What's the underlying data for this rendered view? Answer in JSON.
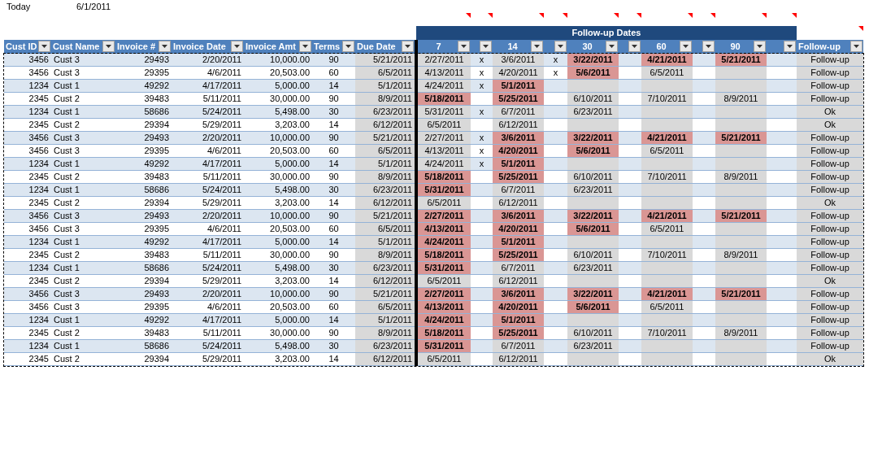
{
  "today": {
    "label": "Today",
    "value": "6/1/2011"
  },
  "group_header": {
    "label": "Follow-up Dates"
  },
  "columns": [
    {
      "label": "Cust ID"
    },
    {
      "label": "Cust Name"
    },
    {
      "label": "Invoice #"
    },
    {
      "label": "Invoice Date"
    },
    {
      "label": "Invoice Amt"
    },
    {
      "label": "Terms"
    },
    {
      "label": "Due Date"
    },
    {
      "label": "7",
      "comment": true
    },
    {
      "comment": true
    },
    {
      "label": "14",
      "comment": true
    },
    {
      "comment": true
    },
    {
      "label": "30",
      "comment": true
    },
    {
      "comment": true
    },
    {
      "label": "60",
      "comment": true
    },
    {
      "comment": true
    },
    {
      "label": "90",
      "comment": true
    },
    {
      "comment": true
    },
    {
      "label": "Follow-up",
      "comment": true
    }
  ],
  "rows": [
    {
      "cust_id": "3456",
      "cust_name": "Cust 3",
      "invoice": "29493",
      "invoice_date": "2/20/2011",
      "invoice_amt": "10,000.00",
      "terms": "90",
      "due_date": "5/21/2011",
      "followups": [
        {
          "date": "2/27/2011",
          "overdue": false
        },
        {
          "date": "3/6/2011",
          "overdue": false
        },
        {
          "date": "3/22/2011",
          "overdue": true
        },
        {
          "date": "4/21/2011",
          "overdue": true
        },
        {
          "date": "5/21/2011",
          "overdue": true
        }
      ],
      "marks": [
        "x",
        "x"
      ],
      "status": "Follow-up"
    },
    {
      "cust_id": "3456",
      "cust_name": "Cust 3",
      "invoice": "29395",
      "invoice_date": "4/6/2011",
      "invoice_amt": "20,503.00",
      "terms": "60",
      "due_date": "6/5/2011",
      "followups": [
        {
          "date": "4/13/2011",
          "overdue": false
        },
        {
          "date": "4/20/2011",
          "overdue": false
        },
        {
          "date": "5/6/2011",
          "overdue": true
        },
        {
          "date": "6/5/2011",
          "overdue": false
        }
      ],
      "marks": [
        "x",
        "x"
      ],
      "status": "Follow-up"
    },
    {
      "cust_id": "1234",
      "cust_name": "Cust 1",
      "invoice": "49292",
      "invoice_date": "4/17/2011",
      "invoice_amt": "5,000.00",
      "terms": "14",
      "due_date": "5/1/2011",
      "followups": [
        {
          "date": "4/24/2011",
          "overdue": false
        },
        {
          "date": "5/1/2011",
          "overdue": true
        }
      ],
      "marks": [
        "x"
      ],
      "status": "Follow-up"
    },
    {
      "cust_id": "2345",
      "cust_name": "Cust 2",
      "invoice": "39483",
      "invoice_date": "5/11/2011",
      "invoice_amt": "30,000.00",
      "terms": "90",
      "due_date": "8/9/2011",
      "followups": [
        {
          "date": "5/18/2011",
          "overdue": true
        },
        {
          "date": "5/25/2011",
          "overdue": true
        },
        {
          "date": "6/10/2011",
          "overdue": false
        },
        {
          "date": "7/10/2011",
          "overdue": false
        },
        {
          "date": "8/9/2011",
          "overdue": false
        }
      ],
      "status": "Follow-up"
    },
    {
      "cust_id": "1234",
      "cust_name": "Cust 1",
      "invoice": "58686",
      "invoice_date": "5/24/2011",
      "invoice_amt": "5,498.00",
      "terms": "30",
      "due_date": "6/23/2011",
      "followups": [
        {
          "date": "5/31/2011",
          "overdue": false
        },
        {
          "date": "6/7/2011",
          "overdue": false
        },
        {
          "date": "6/23/2011",
          "overdue": false
        }
      ],
      "marks": [
        "x"
      ],
      "status": "Ok"
    },
    {
      "cust_id": "2345",
      "cust_name": "Cust 2",
      "invoice": "29394",
      "invoice_date": "5/29/2011",
      "invoice_amt": "3,203.00",
      "terms": "14",
      "due_date": "6/12/2011",
      "followups": [
        {
          "date": "6/5/2011",
          "overdue": false
        },
        {
          "date": "6/12/2011",
          "overdue": false
        }
      ],
      "status": "Ok"
    },
    {
      "cust_id": "3456",
      "cust_name": "Cust 3",
      "invoice": "29493",
      "invoice_date": "2/20/2011",
      "invoice_amt": "10,000.00",
      "terms": "90",
      "due_date": "5/21/2011",
      "followups": [
        {
          "date": "2/27/2011",
          "overdue": false
        },
        {
          "date": "3/6/2011",
          "overdue": true
        },
        {
          "date": "3/22/2011",
          "overdue": true
        },
        {
          "date": "4/21/2011",
          "overdue": true
        },
        {
          "date": "5/21/2011",
          "overdue": true
        }
      ],
      "marks": [
        "x"
      ],
      "status": "Follow-up"
    },
    {
      "cust_id": "3456",
      "cust_name": "Cust 3",
      "invoice": "29395",
      "invoice_date": "4/6/2011",
      "invoice_amt": "20,503.00",
      "terms": "60",
      "due_date": "6/5/2011",
      "followups": [
        {
          "date": "4/13/2011",
          "overdue": false
        },
        {
          "date": "4/20/2011",
          "overdue": true
        },
        {
          "date": "5/6/2011",
          "overdue": true
        },
        {
          "date": "6/5/2011",
          "overdue": false
        }
      ],
      "marks": [
        "x"
      ],
      "status": "Follow-up"
    },
    {
      "cust_id": "1234",
      "cust_name": "Cust 1",
      "invoice": "49292",
      "invoice_date": "4/17/2011",
      "invoice_amt": "5,000.00",
      "terms": "14",
      "due_date": "5/1/2011",
      "followups": [
        {
          "date": "4/24/2011",
          "overdue": false
        },
        {
          "date": "5/1/2011",
          "overdue": true
        }
      ],
      "marks": [
        "x"
      ],
      "status": "Follow-up"
    },
    {
      "cust_id": "2345",
      "cust_name": "Cust 2",
      "invoice": "39483",
      "invoice_date": "5/11/2011",
      "invoice_amt": "30,000.00",
      "terms": "90",
      "due_date": "8/9/2011",
      "followups": [
        {
          "date": "5/18/2011",
          "overdue": true
        },
        {
          "date": "5/25/2011",
          "overdue": true
        },
        {
          "date": "6/10/2011",
          "overdue": false
        },
        {
          "date": "7/10/2011",
          "overdue": false
        },
        {
          "date": "8/9/2011",
          "overdue": false
        }
      ],
      "status": "Follow-up"
    },
    {
      "cust_id": "1234",
      "cust_name": "Cust 1",
      "invoice": "58686",
      "invoice_date": "5/24/2011",
      "invoice_amt": "5,498.00",
      "terms": "30",
      "due_date": "6/23/2011",
      "followups": [
        {
          "date": "5/31/2011",
          "overdue": true
        },
        {
          "date": "6/7/2011",
          "overdue": false
        },
        {
          "date": "6/23/2011",
          "overdue": false
        }
      ],
      "status": "Follow-up"
    },
    {
      "cust_id": "2345",
      "cust_name": "Cust 2",
      "invoice": "29394",
      "invoice_date": "5/29/2011",
      "invoice_amt": "3,203.00",
      "terms": "14",
      "due_date": "6/12/2011",
      "followups": [
        {
          "date": "6/5/2011",
          "overdue": false
        },
        {
          "date": "6/12/2011",
          "overdue": false
        }
      ],
      "status": "Ok"
    },
    {
      "cust_id": "3456",
      "cust_name": "Cust 3",
      "invoice": "29493",
      "invoice_date": "2/20/2011",
      "invoice_amt": "10,000.00",
      "terms": "90",
      "due_date": "5/21/2011",
      "followups": [
        {
          "date": "2/27/2011",
          "overdue": true
        },
        {
          "date": "3/6/2011",
          "overdue": true
        },
        {
          "date": "3/22/2011",
          "overdue": true
        },
        {
          "date": "4/21/2011",
          "overdue": true
        },
        {
          "date": "5/21/2011",
          "overdue": true
        }
      ],
      "status": "Follow-up"
    },
    {
      "cust_id": "3456",
      "cust_name": "Cust 3",
      "invoice": "29395",
      "invoice_date": "4/6/2011",
      "invoice_amt": "20,503.00",
      "terms": "60",
      "due_date": "6/5/2011",
      "followups": [
        {
          "date": "4/13/2011",
          "overdue": true
        },
        {
          "date": "4/20/2011",
          "overdue": true
        },
        {
          "date": "5/6/2011",
          "overdue": true
        },
        {
          "date": "6/5/2011",
          "overdue": false
        }
      ],
      "status": "Follow-up"
    },
    {
      "cust_id": "1234",
      "cust_name": "Cust 1",
      "invoice": "49292",
      "invoice_date": "4/17/2011",
      "invoice_amt": "5,000.00",
      "terms": "14",
      "due_date": "5/1/2011",
      "followups": [
        {
          "date": "4/24/2011",
          "overdue": true
        },
        {
          "date": "5/1/2011",
          "overdue": true
        }
      ],
      "status": "Follow-up"
    },
    {
      "cust_id": "2345",
      "cust_name": "Cust 2",
      "invoice": "39483",
      "invoice_date": "5/11/2011",
      "invoice_amt": "30,000.00",
      "terms": "90",
      "due_date": "8/9/2011",
      "followups": [
        {
          "date": "5/18/2011",
          "overdue": true
        },
        {
          "date": "5/25/2011",
          "overdue": true
        },
        {
          "date": "6/10/2011",
          "overdue": false
        },
        {
          "date": "7/10/2011",
          "overdue": false
        },
        {
          "date": "8/9/2011",
          "overdue": false
        }
      ],
      "status": "Follow-up"
    },
    {
      "cust_id": "1234",
      "cust_name": "Cust 1",
      "invoice": "58686",
      "invoice_date": "5/24/2011",
      "invoice_amt": "5,498.00",
      "terms": "30",
      "due_date": "6/23/2011",
      "followups": [
        {
          "date": "5/31/2011",
          "overdue": true
        },
        {
          "date": "6/7/2011",
          "overdue": false
        },
        {
          "date": "6/23/2011",
          "overdue": false
        }
      ],
      "status": "Follow-up"
    },
    {
      "cust_id": "2345",
      "cust_name": "Cust 2",
      "invoice": "29394",
      "invoice_date": "5/29/2011",
      "invoice_amt": "3,203.00",
      "terms": "14",
      "due_date": "6/12/2011",
      "followups": [
        {
          "date": "6/5/2011",
          "overdue": false
        },
        {
          "date": "6/12/2011",
          "overdue": false
        }
      ],
      "status": "Ok"
    },
    {
      "cust_id": "3456",
      "cust_name": "Cust 3",
      "invoice": "29493",
      "invoice_date": "2/20/2011",
      "invoice_amt": "10,000.00",
      "terms": "90",
      "due_date": "5/21/2011",
      "followups": [
        {
          "date": "2/27/2011",
          "overdue": true
        },
        {
          "date": "3/6/2011",
          "overdue": true
        },
        {
          "date": "3/22/2011",
          "overdue": true
        },
        {
          "date": "4/21/2011",
          "overdue": true
        },
        {
          "date": "5/21/2011",
          "overdue": true
        }
      ],
      "status": "Follow-up"
    },
    {
      "cust_id": "3456",
      "cust_name": "Cust 3",
      "invoice": "29395",
      "invoice_date": "4/6/2011",
      "invoice_amt": "20,503.00",
      "terms": "60",
      "due_date": "6/5/2011",
      "followups": [
        {
          "date": "4/13/2011",
          "overdue": true
        },
        {
          "date": "4/20/2011",
          "overdue": true
        },
        {
          "date": "5/6/2011",
          "overdue": true
        },
        {
          "date": "6/5/2011",
          "overdue": false
        }
      ],
      "status": "Follow-up"
    },
    {
      "cust_id": "1234",
      "cust_name": "Cust 1",
      "invoice": "49292",
      "invoice_date": "4/17/2011",
      "invoice_amt": "5,000.00",
      "terms": "14",
      "due_date": "5/1/2011",
      "followups": [
        {
          "date": "4/24/2011",
          "overdue": true
        },
        {
          "date": "5/1/2011",
          "overdue": true
        }
      ],
      "status": "Follow-up"
    },
    {
      "cust_id": "2345",
      "cust_name": "Cust 2",
      "invoice": "39483",
      "invoice_date": "5/11/2011",
      "invoice_amt": "30,000.00",
      "terms": "90",
      "due_date": "8/9/2011",
      "followups": [
        {
          "date": "5/18/2011",
          "overdue": true
        },
        {
          "date": "5/25/2011",
          "overdue": true
        },
        {
          "date": "6/10/2011",
          "overdue": false
        },
        {
          "date": "7/10/2011",
          "overdue": false
        },
        {
          "date": "8/9/2011",
          "overdue": false
        }
      ],
      "status": "Follow-up"
    },
    {
      "cust_id": "1234",
      "cust_name": "Cust 1",
      "invoice": "58686",
      "invoice_date": "5/24/2011",
      "invoice_amt": "5,498.00",
      "terms": "30",
      "due_date": "6/23/2011",
      "followups": [
        {
          "date": "5/31/2011",
          "overdue": true
        },
        {
          "date": "6/7/2011",
          "overdue": false
        },
        {
          "date": "6/23/2011",
          "overdue": false
        }
      ],
      "status": "Follow-up"
    },
    {
      "cust_id": "2345",
      "cust_name": "Cust 2",
      "invoice": "29394",
      "invoice_date": "5/29/2011",
      "invoice_amt": "3,203.00",
      "terms": "14",
      "due_date": "6/12/2011",
      "followups": [
        {
          "date": "6/5/2011",
          "overdue": false
        },
        {
          "date": "6/12/2011",
          "overdue": false
        }
      ],
      "status": "Ok"
    }
  ]
}
